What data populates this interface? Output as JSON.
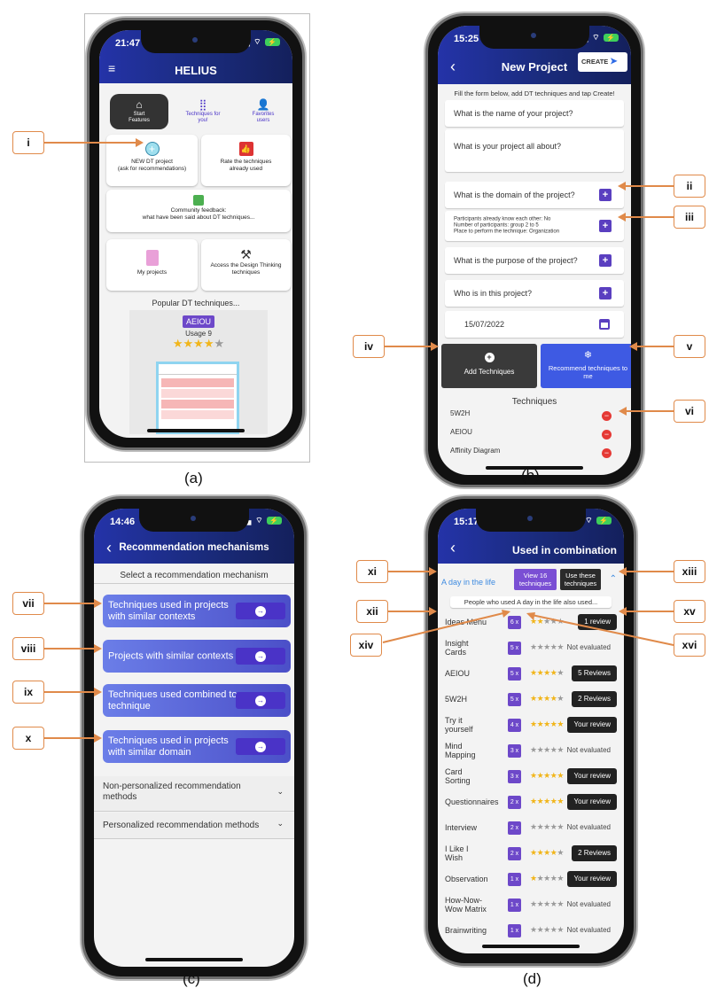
{
  "panels": {
    "a": "(a)",
    "b": "(b)",
    "c": "(c)",
    "d": "(d)"
  },
  "callouts": {
    "i": "i",
    "ii": "ii",
    "iii": "iii",
    "iv": "iv",
    "v": "v",
    "vi": "vi",
    "vii": "vii",
    "viii": "viii",
    "ix": "ix",
    "x": "x",
    "xi": "xi",
    "xii": "xii",
    "xiii": "xiii",
    "xiv": "xiv",
    "xv": "xv",
    "xvi": "xvi"
  },
  "screen_a": {
    "time": "21:47",
    "title": "HELIUS",
    "tabs": [
      "Start\nFeatures",
      "Techniques for\nyou!",
      "Favorites\nusers"
    ],
    "cards": {
      "new_project": "NEW DT project\n(ask for recommendations)",
      "rate": "Rate the techniques\nalready used",
      "community": "Community feedback:\nwhat have been said about DT techniques...",
      "my_projects": "My projects",
      "access": "Access the Design Thinking\ntechniques"
    },
    "popular_title": "Popular DT techniques...",
    "popular_name": "AEIOU",
    "popular_usage": "Usage 9",
    "popular_stars": 4
  },
  "screen_b": {
    "time": "15:25",
    "title": "New Project",
    "create": "CREATE",
    "hint": "Fill the form below, add DT techniques and tap Create!",
    "fields": {
      "name": "What is the name of your project?",
      "about": "What is your project all about?",
      "domain": "What is the domain of the project?",
      "participants": "Participants already know each other: No\nNumber of participants: group 2 to 5\nPlace to perform the technique: Organization",
      "purpose": "What is the purpose of the project?",
      "who": "Who is in this project?",
      "date": "15/07/2022"
    },
    "add_btn": "Add Techniques",
    "recommend_btn": "Recommend techniques to me",
    "techniques_title": "Techniques",
    "techniques": [
      "5W2H",
      "AEIOU",
      "Affinity Diagram"
    ]
  },
  "screen_c": {
    "time": "14:46",
    "title": "Recommendation mechanisms",
    "subtitle": "Select a recommendation mechanism",
    "mechanisms": [
      "Techniques used in projects with similar contexts",
      "Projects with similar contexts",
      "Techniques used combined to a technique",
      "Techniques used in projects with similar domain"
    ],
    "accordions": [
      "Non-personalized recommendation methods",
      "Personalized recommendation methods"
    ]
  },
  "screen_d": {
    "time": "15:17",
    "title": "Used in combination",
    "selected": "A day in the life",
    "view_btn": "View 16 techniques",
    "use_btn": "Use these techniques",
    "caption": "People who used A day in the life also used...",
    "rows": [
      {
        "name": "Ideas Menu",
        "count": "6 x",
        "stars": 2,
        "review": "1 review",
        "dark": true
      },
      {
        "name": "Insight Cards",
        "count": "5 x",
        "stars": 0,
        "review": "Not evaluated",
        "dark": false
      },
      {
        "name": "AEIOU",
        "count": "5 x",
        "stars": 4,
        "review": "5 Reviews",
        "dark": true
      },
      {
        "name": "5W2H",
        "count": "5 x",
        "stars": 4,
        "review": "2 Reviews",
        "dark": true
      },
      {
        "name": "Try it yourself",
        "count": "4 x",
        "stars": 5,
        "review": "Your review",
        "dark": true
      },
      {
        "name": "Mind Mapping",
        "count": "3 x",
        "stars": 0,
        "review": "Not evaluated",
        "dark": false
      },
      {
        "name": "Card Sorting",
        "count": "3 x",
        "stars": 5,
        "review": "Your review",
        "dark": true
      },
      {
        "name": "Questionnaires",
        "count": "2 x",
        "stars": 5,
        "review": "Your review",
        "dark": true
      },
      {
        "name": "Interview",
        "count": "2 x",
        "stars": 0,
        "review": "Not evaluated",
        "dark": false
      },
      {
        "name": "I Like I Wish",
        "count": "2 x",
        "stars": 4,
        "review": "2 Reviews",
        "dark": true
      },
      {
        "name": "Observation",
        "count": "1 x",
        "stars": 1,
        "review": "Your review",
        "dark": true
      },
      {
        "name": "How-Now-Wow Matrix",
        "count": "1 x",
        "stars": 0,
        "review": "Not evaluated",
        "dark": false
      },
      {
        "name": "Brainwriting",
        "count": "1 x",
        "stars": 0,
        "review": "Not evaluated",
        "dark": false
      }
    ]
  }
}
